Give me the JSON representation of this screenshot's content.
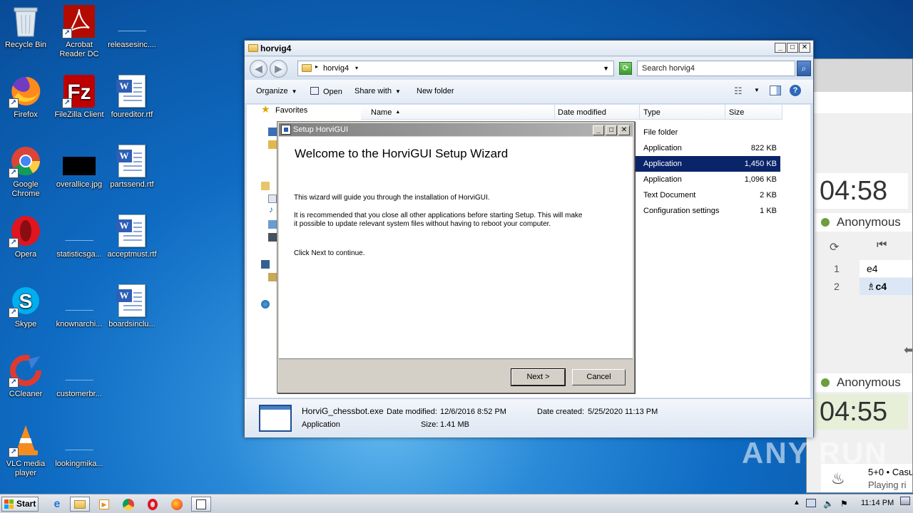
{
  "desktop": {
    "icons": [
      {
        "label": "Recycle Bin"
      },
      {
        "label": "Acrobat Reader DC"
      },
      {
        "label": "releasesinc...."
      },
      {
        "label": "Firefox"
      },
      {
        "label": "FileZilla Client"
      },
      {
        "label": "foureditor.rtf"
      },
      {
        "label": "Google Chrome"
      },
      {
        "label": "overallice.jpg"
      },
      {
        "label": "partssend.rtf"
      },
      {
        "label": "Opera"
      },
      {
        "label": "statisticsga..."
      },
      {
        "label": "acceptmust.rtf"
      },
      {
        "label": "Skype"
      },
      {
        "label": "knownarchi..."
      },
      {
        "label": "boardsinclu..."
      },
      {
        "label": "CCleaner"
      },
      {
        "label": "customerbr..."
      },
      {
        "label": "VLC media player"
      },
      {
        "label": "lookingmika..."
      }
    ]
  },
  "chess": {
    "clock_top": "04:58",
    "player_top": "Anonymous",
    "moves": [
      {
        "num": "1",
        "move": "e4"
      },
      {
        "num": "2",
        "move": "♗c4"
      }
    ],
    "player_bottom": "Anonymous",
    "clock_bottom": "04:55",
    "game_info_line1": "5+0 • Casu",
    "game_info_line2": "Playing ri"
  },
  "explorer": {
    "title": "horvig4",
    "address": "horvig4",
    "search_placeholder": "Search horvig4",
    "toolbar": {
      "organize": "Organize",
      "open": "Open",
      "share_with": "Share with",
      "new_folder": "New folder"
    },
    "nav": {
      "favorites": "Favorites"
    },
    "columns": {
      "name": "Name",
      "date_modified": "Date modified",
      "type": "Type",
      "size": "Size"
    },
    "rows": [
      {
        "type": "File folder",
        "size": ""
      },
      {
        "type": "Application",
        "size": "822 KB"
      },
      {
        "type": "Application",
        "size": "1,450 KB"
      },
      {
        "type": "Application",
        "size": "1,096 KB"
      },
      {
        "type": "Text Document",
        "size": "2 KB"
      },
      {
        "type": "Configuration settings",
        "size": "1 KB"
      }
    ],
    "details": {
      "filename": "HorviG_chessbot.exe",
      "date_modified_label": "Date modified:",
      "date_modified": "12/6/2016 8:52 PM",
      "date_created_label": "Date created:",
      "date_created": "5/25/2020 11:13 PM",
      "type": "Application",
      "size_label": "Size:",
      "size": "1.41 MB"
    }
  },
  "setup": {
    "title": "Setup HorviGUI",
    "heading": "Welcome to the HorviGUI Setup Wizard",
    "para1": "This wizard will guide you through the installation of HorviGUI.",
    "para2": "It is recommended that you close all other applications before starting Setup. This will make it possible to update relevant system files without having to reboot your computer.",
    "para3": "Click Next to continue.",
    "next": "Next >",
    "cancel": "Cancel"
  },
  "taskbar": {
    "start": "Start",
    "clock": "11:14 PM"
  },
  "watermark": "ANY RUN"
}
